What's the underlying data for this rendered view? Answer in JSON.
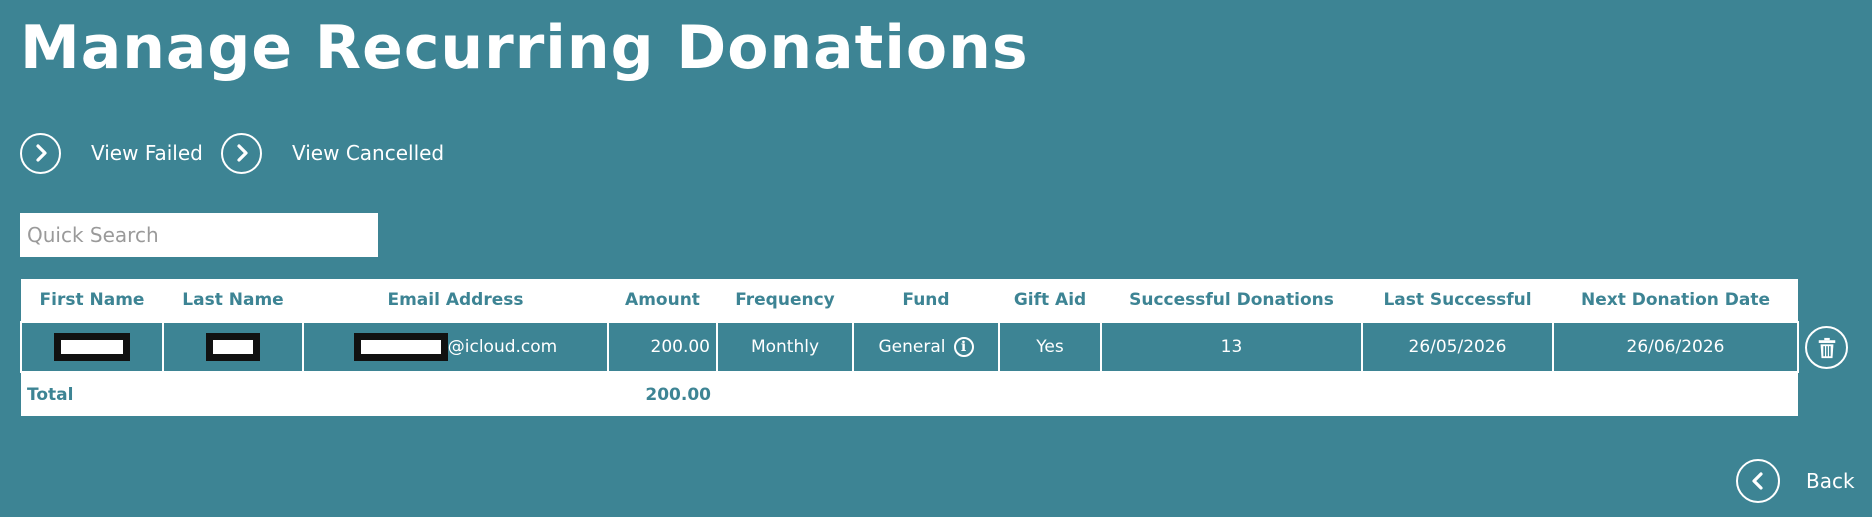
{
  "page": {
    "title": "Manage Recurring Donations"
  },
  "links": {
    "view_failed": "View Failed",
    "view_cancelled": "View Cancelled",
    "back": "Back"
  },
  "search": {
    "placeholder": "Quick Search",
    "value": ""
  },
  "table": {
    "headers": {
      "first_name": "First Name",
      "last_name": "Last Name",
      "email": "Email Address",
      "amount": "Amount",
      "frequency": "Frequency",
      "fund": "Fund",
      "gift_aid": "Gift Aid",
      "successful": "Successful Donations",
      "last_successful": "Last Successful",
      "next_date": "Next Donation Date"
    },
    "rows": [
      {
        "email_domain": "@icloud.com",
        "amount": "200.00",
        "frequency": "Monthly",
        "fund": "General",
        "gift_aid": "Yes",
        "successful": "13",
        "last_successful": "26/05/2026",
        "next_date": "26/06/2026"
      }
    ],
    "total": {
      "label": "Total",
      "amount": "200.00"
    }
  },
  "icons": {
    "view_failed": "chevron-right-circle-icon",
    "view_cancelled": "chevron-right-circle-icon",
    "back": "chevron-left-circle-icon",
    "delete": "trash-icon",
    "fund_info": "info-icon"
  },
  "colors": {
    "background": "#3d8494",
    "header_bg": "#ffffff",
    "accent_text": "#3d8494",
    "redaction": "#111111"
  }
}
